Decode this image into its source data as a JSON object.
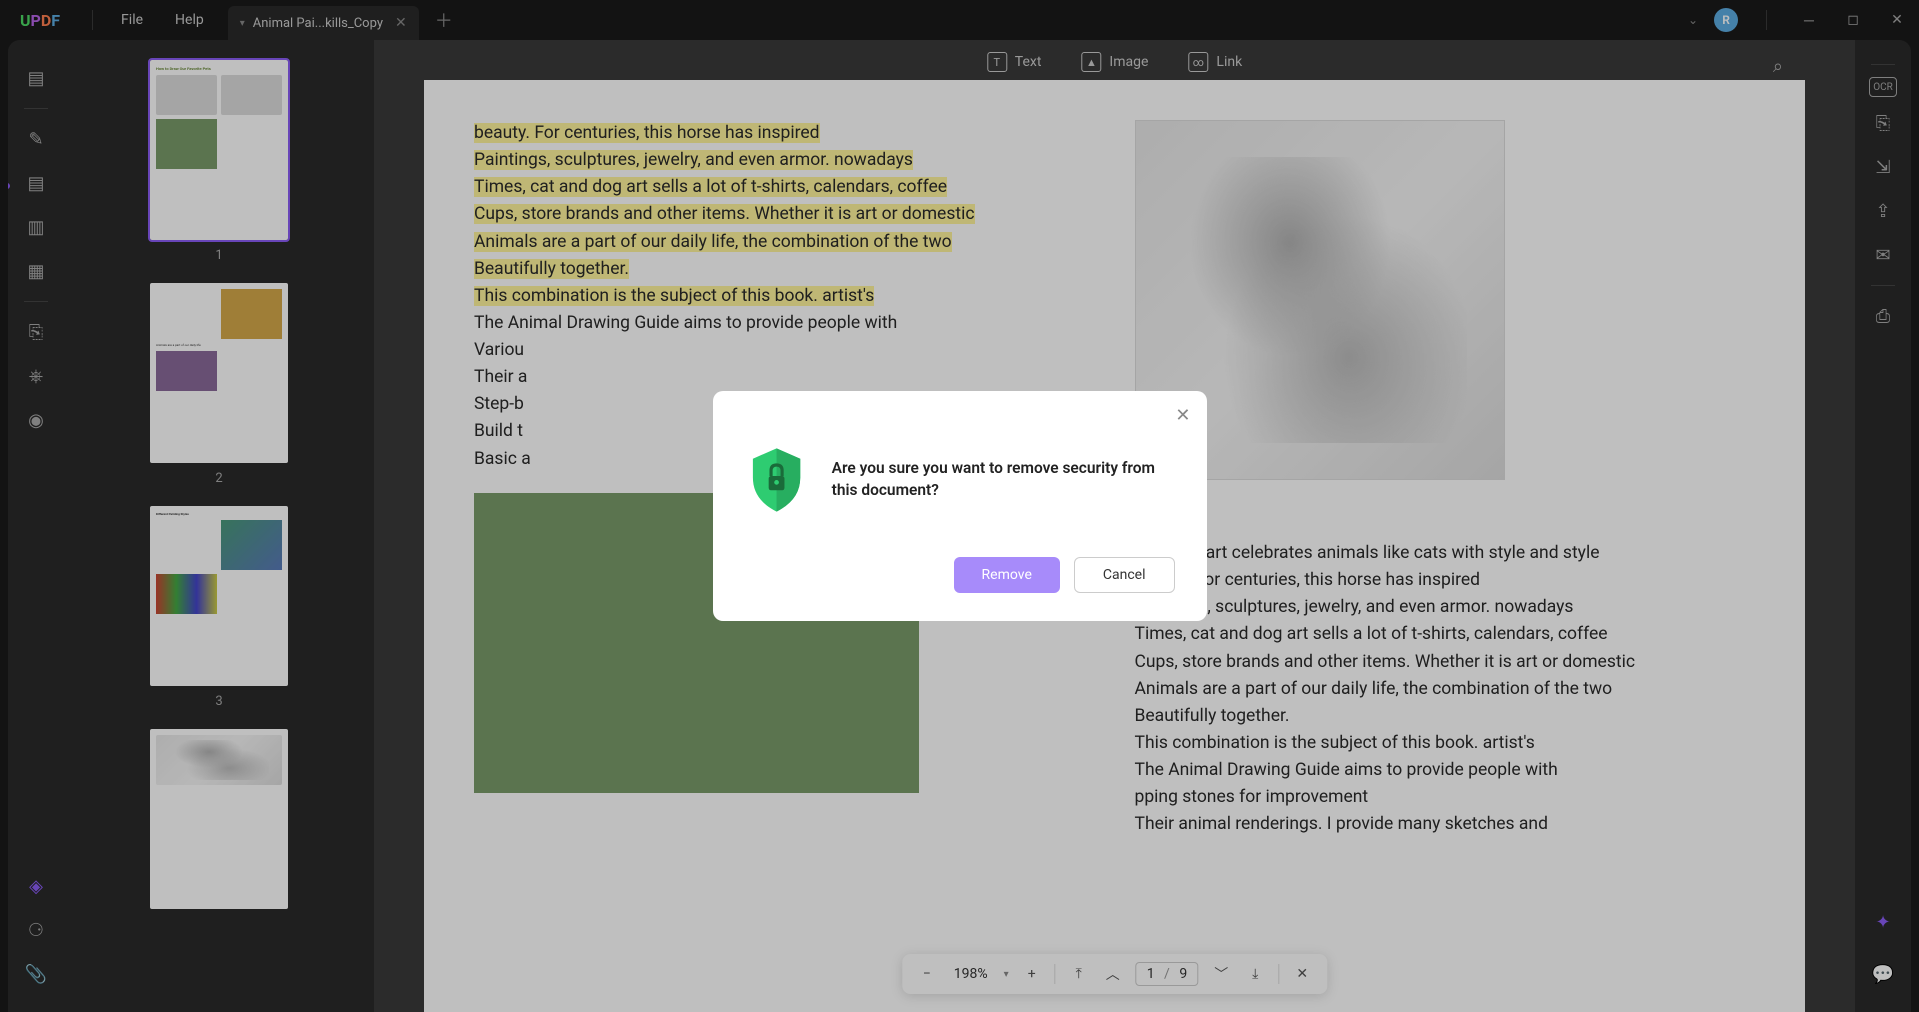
{
  "logo": {
    "u": "U",
    "p": "P",
    "d": "D",
    "f": "F"
  },
  "menu": {
    "file": "File",
    "help": "Help"
  },
  "tab": {
    "title": "Animal Pai...kills_Copy"
  },
  "avatar_initial": "R",
  "top_tools": {
    "text": "Text",
    "image": "Image",
    "link": "Link"
  },
  "thumbs": {
    "n1": "1",
    "n2": "2",
    "n3": "3"
  },
  "page": {
    "l1": "beauty. For centuries, this horse has inspired",
    "l2": "Paintings, sculptures, jewelry, and even armor. nowadays",
    "l3": "Times, cat and dog art sells a lot of t-shirts, calendars, coffee",
    "l4": "Cups, store brands and other items. Whether it is art or domestic",
    "l5": "Animals are a part of our daily life, the combination of the two",
    "l6": "Beautifully together.",
    "l7": "This combination is the subject of this book. artist's",
    "l8": "The Animal Drawing Guide aims to provide people with",
    "l9": "Variou",
    "l10": "Their a",
    "l11": "Step-b",
    "l12": "Build t",
    "l13": "Basic a",
    "r1": "Egyptian art celebrates animals like cats with style and style",
    "r2": "beauty. For centuries, this horse has inspired",
    "r3": "Paintings, sculptures, jewelry, and even armor. nowadays",
    "r4": "Times, cat and dog art sells a lot of t-shirts, calendars, coffee",
    "r5": "Cups, store brands and other items. Whether it is art or domestic",
    "r6": "Animals are a part of our daily life, the combination of the two",
    "r7": "Beautifully together.",
    "r8": "This combination is the subject of this book. artist's",
    "r9": "The Animal Drawing Guide aims to provide people with",
    "r10": "pping stones for improvement",
    "r11": "Their animal renderings. I provide many sketches and"
  },
  "zoom": {
    "value": "198%"
  },
  "pagenav": {
    "current": "1",
    "sep": "/",
    "total": "9"
  },
  "modal": {
    "message": "Are you sure you want to remove security from this document?",
    "remove": "Remove",
    "cancel": "Cancel"
  }
}
